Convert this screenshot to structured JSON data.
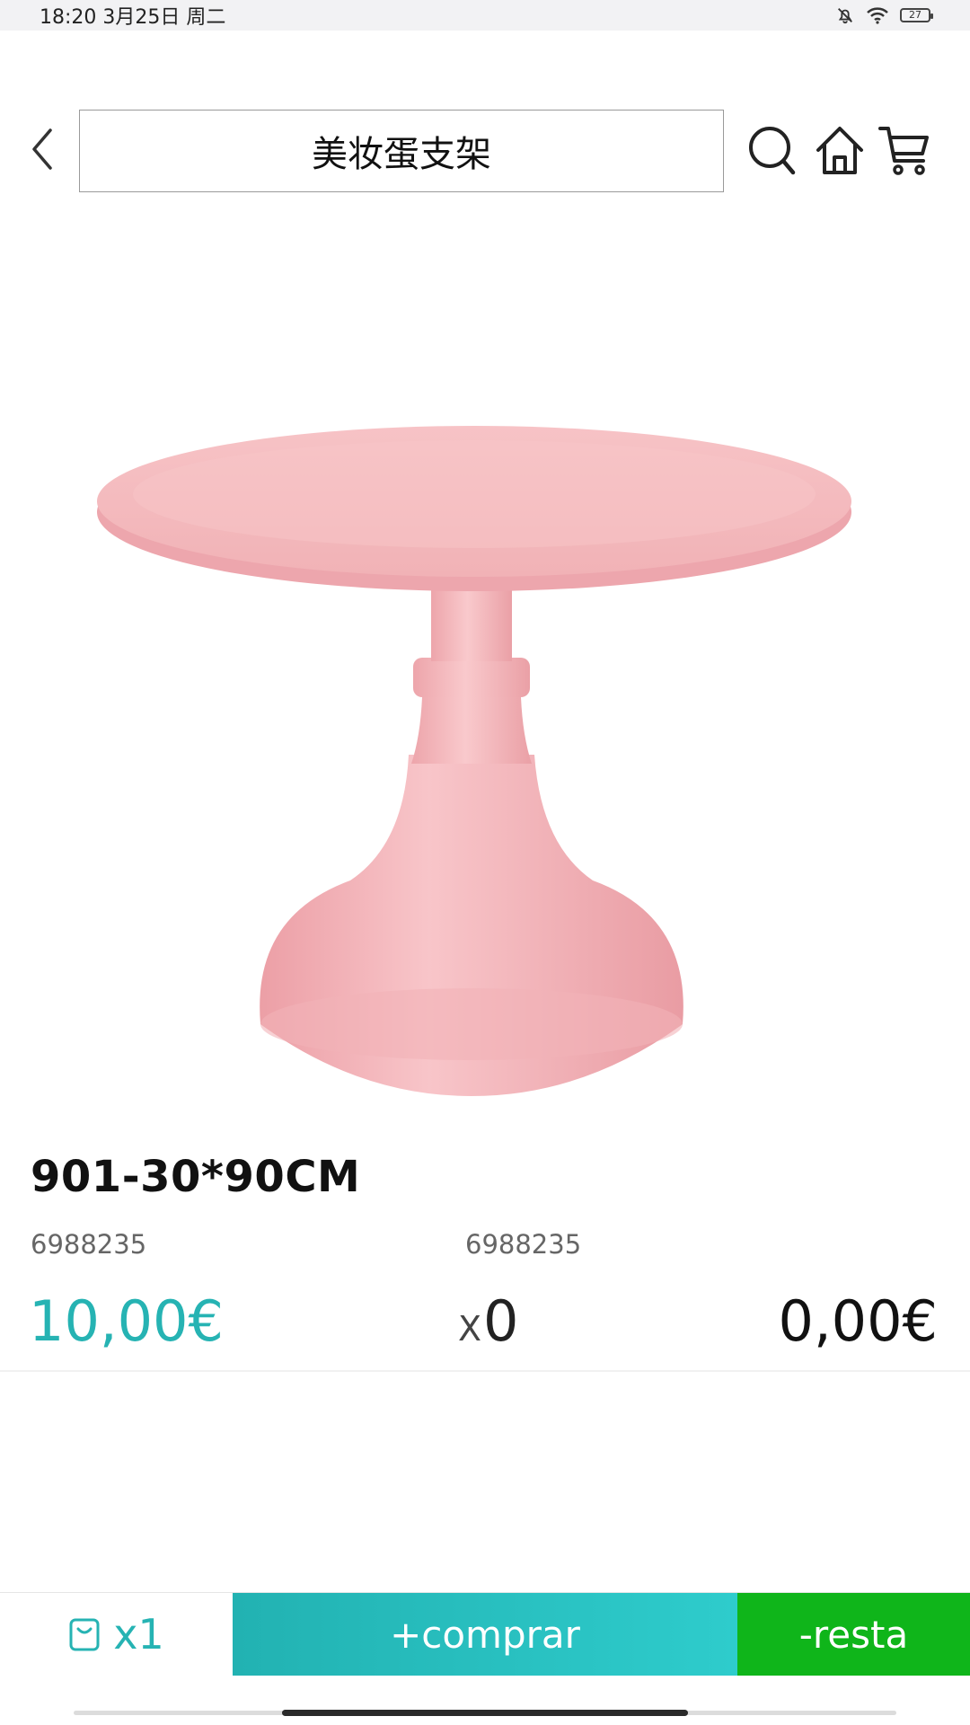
{
  "status_bar": {
    "time_date": "18:20 3月25日 周二",
    "battery": "27",
    "icons": [
      "bell-muted-icon",
      "wifi-icon",
      "battery-icon"
    ]
  },
  "header": {
    "title": "美妆蛋支架",
    "icons": [
      "back-arrow-icon",
      "search-icon",
      "home-icon",
      "cart-icon"
    ]
  },
  "product": {
    "name": "901-30*90CM",
    "code_left": "6988235",
    "code_right": "6988235",
    "price": "10,00€",
    "qty_prefix": "X",
    "qty": "0",
    "total": "0,00€"
  },
  "bottom_bar": {
    "bag_count": "x1",
    "buy_label": "+comprar",
    "remove_label": "-resta",
    "colors": {
      "accent": "#26b3b3",
      "buy": "#22b2b2",
      "remove": "#0fb51a"
    }
  }
}
